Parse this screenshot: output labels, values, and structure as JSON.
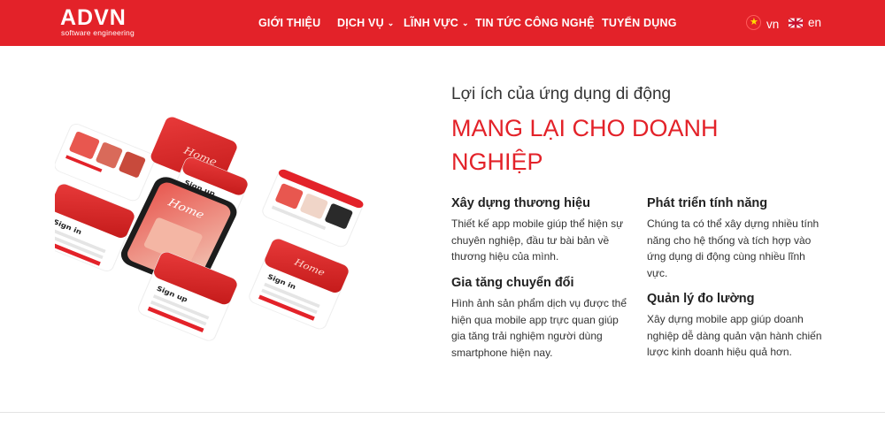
{
  "brand": {
    "name": "ADVN",
    "tagline": "software engineering",
    "primary_color": "#e32229"
  },
  "nav": {
    "items": [
      {
        "label": "GIỚI THIỆU",
        "dropdown": false
      },
      {
        "label": "DỊCH VỤ",
        "dropdown": true
      },
      {
        "label": "LĨNH VỰC",
        "dropdown": true
      },
      {
        "label": "TIN TỨC CÔNG NGHỆ",
        "dropdown": false
      },
      {
        "label": "TUYỂN DỤNG",
        "dropdown": false
      }
    ],
    "languages": [
      {
        "code": "vn",
        "flag_icon": "vietnam-flag-icon"
      },
      {
        "code": "en",
        "flag_icon": "uk-flag-icon"
      }
    ]
  },
  "hero": {
    "subtitle": "Lợi ích của ứng dụng di động",
    "headline": "MANG LẠI CHO DOANH NGHIỆP",
    "mockup_texts": {
      "sign_in": "Sign in",
      "sign_up": "Sign up",
      "home": "Home"
    }
  },
  "features": [
    {
      "title": "Xây dựng thương hiệu",
      "text": "Thiết kế app mobile giúp thể hiện sự chuyên nghiệp, đầu tư bài bản về thương hiệu của mình."
    },
    {
      "title": "Gia tăng chuyển đổi",
      "text": "Hình ảnh sản phẩm dịch vụ được thể hiện qua mobile app trực quan giúp gia tăng trải nghiệm người dùng smartphone hiện nay."
    },
    {
      "title": "Phát triển tính năng",
      "text": "Chúng ta có thể xây dựng nhiều tính năng cho hệ thống và tích hợp vào ứng dụng di động cùng nhiều lĩnh vực."
    },
    {
      "title": "Quản lý đo lường",
      "text": "Xây dựng mobile app giúp doanh nghiệp dễ dàng quản vận hành chiến lược kinh doanh hiệu quả hơn."
    }
  ]
}
